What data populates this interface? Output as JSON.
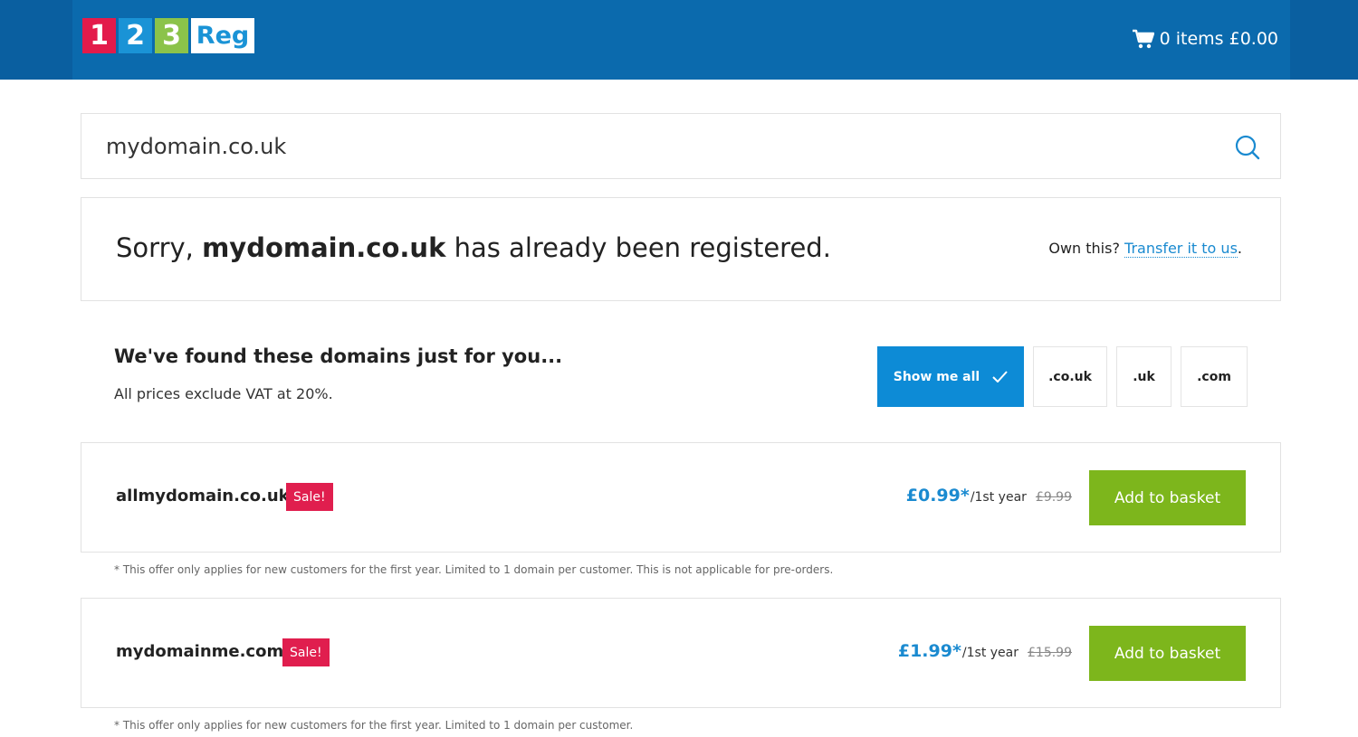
{
  "header": {
    "logo": {
      "d1": "1",
      "d2": "2",
      "d3": "3",
      "word": "Reg"
    },
    "cart_text": "0 items £0.00"
  },
  "search": {
    "value": "mydomain.co.uk"
  },
  "registered": {
    "prefix": "Sorry, ",
    "domain": "mydomain.co.uk",
    "suffix": " has already been registered.",
    "own_prefix": "Own this? ",
    "transfer_link": "Transfer it to us",
    "own_suffix": "."
  },
  "suggestions": {
    "title": "We've found these domains just for you...",
    "subtitle": "All prices exclude VAT at 20%.",
    "filters": [
      {
        "label": "Show me all",
        "active": true
      },
      {
        "label": ".co.uk",
        "active": false
      },
      {
        "label": ".uk",
        "active": false
      },
      {
        "label": ".com",
        "active": false
      }
    ]
  },
  "domains": [
    {
      "name": "allmydomain.co.uk",
      "badge": "Sale!",
      "price": "£0.99*",
      "period": "/1st year",
      "old_price": "£9.99",
      "button": "Add to basket",
      "note": "*  This offer only applies for new customers for the first year. Limited to 1 domain per customer. This is not applicable for pre-orders."
    },
    {
      "name": "mydomainme.com",
      "badge": "Sale!",
      "price": "£1.99*",
      "period": "/1st year",
      "old_price": "£15.99",
      "button": "Add to basket",
      "note": "*  This offer only applies for new customers for the first year. Limited to 1 domain per customer."
    }
  ],
  "colors": {
    "header": "#0b6aad",
    "accent_blue": "#1a8ad0",
    "sale_red": "#e01e4e",
    "add_green": "#7db61c"
  }
}
